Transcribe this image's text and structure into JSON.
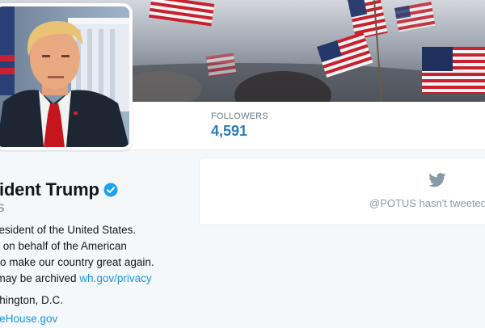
{
  "colors": {
    "link": "#1b95e0",
    "stat_value": "#2b7bb9",
    "muted": "#657786",
    "verified_badge": "#1da1f2",
    "page_bg": "#f5f8fa"
  },
  "header": {
    "banner_description_icon": "american-flags-crowd-photo"
  },
  "stats": {
    "followers_label": "FOLLOWERS",
    "followers_count": "4,591"
  },
  "profile": {
    "name": "sident Trump",
    "verified_icon": "verified-badge-icon",
    "handle": "US",
    "bio_line_1": "President of the United States.",
    "bio_line_2": "ng on behalf of the American",
    "bio_line_3": "e to make our country great again.",
    "bio_line_4_prefix": "s may be archived ",
    "bio_link": "wh.gov/privacy",
    "location": "ashington, D.C.",
    "website": "niteHouse.gov"
  },
  "timeline": {
    "empty_icon": "twitter-bird-icon",
    "empty_text": "@POTUS hasn't tweeted"
  }
}
